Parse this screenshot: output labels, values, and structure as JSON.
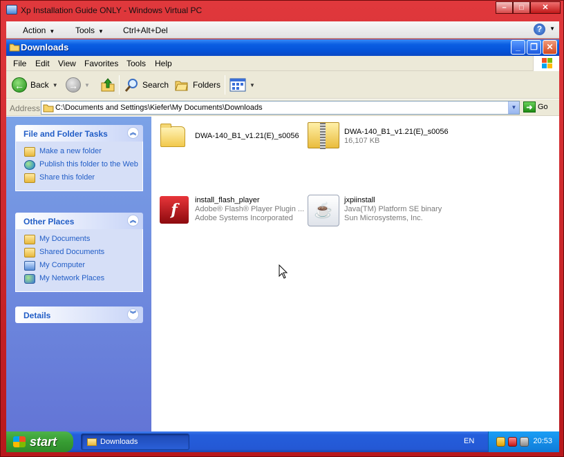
{
  "vpc": {
    "title": "Xp Installation Guide ONLY - Windows Virtual PC",
    "menu": [
      "Action",
      "Tools",
      "Ctrl+Alt+Del"
    ],
    "help": "?"
  },
  "explorer": {
    "title": "Downloads",
    "menu": [
      "File",
      "Edit",
      "View",
      "Favorites",
      "Tools",
      "Help"
    ],
    "toolbar": {
      "back": "Back",
      "search": "Search",
      "folders": "Folders"
    },
    "address_label": "Address",
    "address_value": "C:\\Documents and Settings\\Kiefer\\My Documents\\Downloads",
    "go": "Go"
  },
  "tasks_panel": {
    "title": "File and Folder Tasks",
    "items": [
      "Make a new folder",
      "Publish this folder to the Web",
      "Share this folder"
    ]
  },
  "places_panel": {
    "title": "Other Places",
    "items": [
      "My Documents",
      "Shared Documents",
      "My Computer",
      "My Network Places"
    ]
  },
  "details_panel": {
    "title": "Details"
  },
  "files": [
    {
      "name": "DWA-140_B1_v1.21(E)_s0056",
      "line2": "",
      "line3": "",
      "icon": "folder-icon"
    },
    {
      "name": "DWA-140_B1_v1.21(E)_s0056",
      "line2": "16,107 KB",
      "line3": "",
      "icon": "zip-folder-icon"
    },
    {
      "name": "install_flash_player",
      "line2": "Adobe® Flash® Player Plugin ...",
      "line3": "Adobe Systems Incorporated",
      "icon": "flash-icon"
    },
    {
      "name": "jxpiinstall",
      "line2": "Java(TM) Platform SE binary",
      "line3": "Sun Microsystems, Inc.",
      "icon": "java-icon"
    }
  ],
  "taskbar": {
    "start": "start",
    "task_button": "Downloads",
    "language": "EN",
    "clock": "20:53"
  }
}
